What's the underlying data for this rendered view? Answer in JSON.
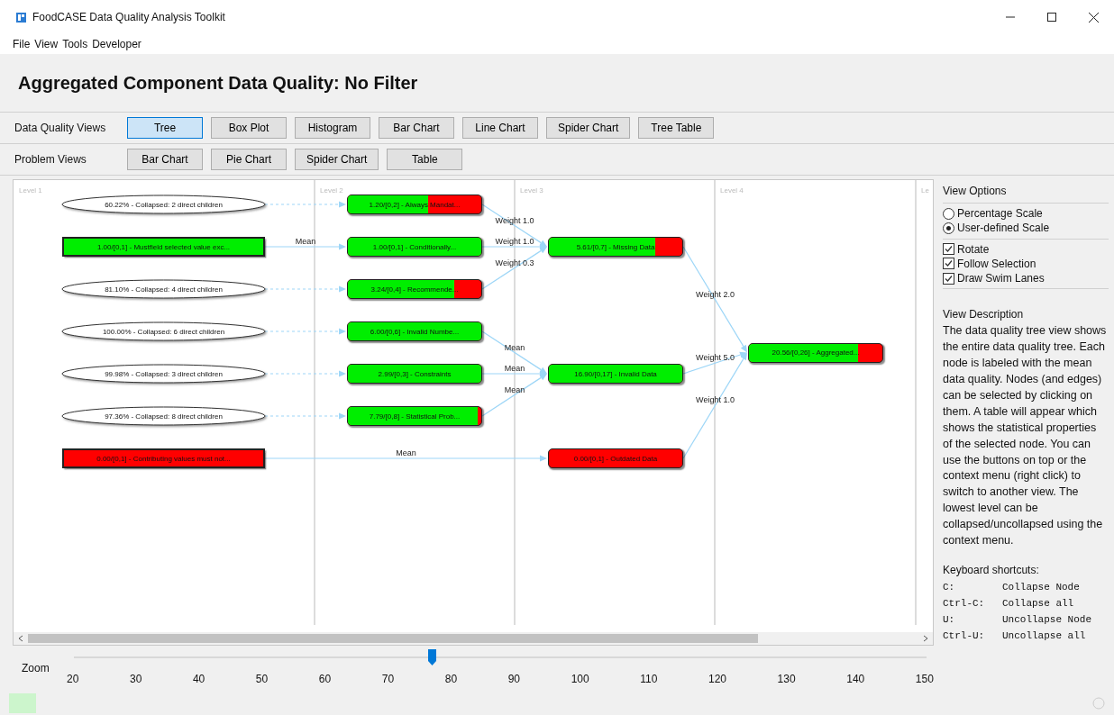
{
  "window": {
    "title": "FoodCASE Data Quality Analysis Toolkit"
  },
  "menu": [
    "File",
    "View",
    "Tools",
    "Developer"
  ],
  "heading": "Aggregated Component Data Quality: No Filter",
  "view_rows": [
    {
      "label": "Data Quality Views",
      "buttons": [
        {
          "label": "Tree",
          "selected": true
        },
        {
          "label": "Box Plot",
          "selected": false
        },
        {
          "label": "Histogram",
          "selected": false
        },
        {
          "label": "Bar Chart",
          "selected": false
        },
        {
          "label": "Line Chart",
          "selected": false
        },
        {
          "label": "Spider Chart",
          "selected": false
        },
        {
          "label": "Tree Table",
          "selected": false
        }
      ]
    },
    {
      "label": "Problem Views",
      "buttons": [
        {
          "label": "Bar Chart",
          "selected": false
        },
        {
          "label": "Pie Chart",
          "selected": false
        },
        {
          "label": "Spider Chart",
          "selected": false
        },
        {
          "label": "Table",
          "selected": false
        }
      ]
    }
  ],
  "lanes": [
    "Level 1",
    "Level 2",
    "Level 3",
    "Level 4",
    "Le"
  ],
  "tree": {
    "kind": "node",
    "label": "20.56/[0,26] - Aggregated...",
    "level": 0.82,
    "children": [
      {
        "kind": "node",
        "label": "5.61/[0,7] - Missing Data",
        "level": 0.8,
        "edge_label": "Weight 2.0",
        "children": [
          {
            "kind": "node",
            "label": "1.20/[0,2] - Always Mandat...",
            "level": 0.6,
            "edge_label": "Weight 1.0",
            "children": [
              {
                "kind": "collapsed",
                "label": "60.22% - Collapsed: 2 direct children"
              }
            ]
          },
          {
            "kind": "node",
            "label": "1.00/[0,1] - Conditionally...",
            "level": 1,
            "edge_label": "Weight 1.0",
            "children": [
              {
                "kind": "node",
                "label": "1.00/[0,1] - Mustfield selected value exc...",
                "level": 1,
                "edge_label": "Mean"
              }
            ]
          },
          {
            "kind": "node",
            "label": "3.24/[0,4] - Recommende...",
            "level": 0.8,
            "edge_label": "Weight 0.3",
            "children": [
              {
                "kind": "collapsed",
                "label": "81.10% - Collapsed: 4 direct children"
              }
            ]
          }
        ]
      },
      {
        "kind": "node",
        "label": "16.90/[0,17] - Invalid Data",
        "level": 1,
        "edge_label": "Weight 5.0",
        "children": [
          {
            "kind": "node",
            "label": "6.00/[0,6] - Invalid Numbe...",
            "level": 1,
            "edge_label": "Mean",
            "children": [
              {
                "kind": "collapsed",
                "label": "100.00% - Collapsed: 6 direct children"
              }
            ]
          },
          {
            "kind": "node",
            "label": "2.99/[0,3] - Constraints",
            "level": 1,
            "edge_label": "Mean",
            "children": [
              {
                "kind": "collapsed",
                "label": "99.98% - Collapsed: 3 direct children"
              }
            ]
          },
          {
            "kind": "node",
            "label": "7.79/[0,8] - Statistical Prob...",
            "level": 0.97,
            "edge_label": "Mean",
            "children": [
              {
                "kind": "collapsed",
                "label": "97.36% - Collapsed: 8 direct children"
              }
            ]
          }
        ]
      },
      {
        "kind": "node",
        "label": "0.00/[0,1] - Outdated Data",
        "edge_label": "Weight 1.0",
        "children": [
          {
            "kind": "node",
            "label": "0.00/[0,1] - Contributing values must not...",
            "edge_label": "Mean"
          }
        ]
      }
    ]
  },
  "zoom": {
    "label": "Zoom",
    "level": 0.42,
    "ticks": [
      "20",
      "30",
      "40",
      "50",
      "60",
      "70",
      "80",
      "90",
      "100",
      "110",
      "120",
      "130",
      "140",
      "150"
    ]
  },
  "view_options": {
    "title": "View Options",
    "scales": [
      {
        "label": "Percentage Scale",
        "selected": false
      },
      {
        "label": "User-defined Scale",
        "selected": true
      }
    ],
    "checks": [
      {
        "label": "Rotate",
        "checked": true
      },
      {
        "label": "Follow Selection",
        "checked": true
      },
      {
        "label": "Draw Swim Lanes",
        "checked": true
      }
    ]
  },
  "view_description": {
    "title": "View Description",
    "text": "The data quality tree view shows the entire data quality tree. Each node is labeled with the mean data quality. Nodes (and edges) can be selected by clicking on them. A table will appear which shows the statistical properties of the selected node. You can use the buttons on top or the context menu (right click) to switch to another view. The lowest level can be collapsed/uncollapsed using the context menu."
  },
  "shortcuts": {
    "title": "Keyboard shortcuts:",
    "items": [
      {
        "key": "C:",
        "action": "Collapse Node"
      },
      {
        "key": "Ctrl-C:",
        "action": "Collapse all"
      },
      {
        "key": "U:",
        "action": "Uncollapse Node"
      },
      {
        "key": "Ctrl-U:",
        "action": "Uncollapse all"
      }
    ]
  }
}
